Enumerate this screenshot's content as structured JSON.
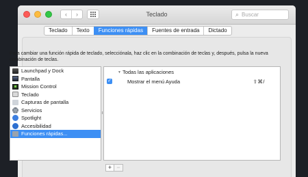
{
  "window": {
    "title": "Teclado",
    "search_placeholder": "Buscar"
  },
  "nav": {
    "back_glyph": "‹",
    "forward_glyph": "›"
  },
  "icons": {
    "search_glyph": "⌕",
    "checkmark_glyph": "✓",
    "disclosure_glyph": "▼"
  },
  "tabs": [
    {
      "label": "Teclado",
      "active": false
    },
    {
      "label": "Texto",
      "active": false
    },
    {
      "label": "Funciones rápidas",
      "active": true
    },
    {
      "label": "Fuentes de entrada",
      "active": false
    },
    {
      "label": "Dictado",
      "active": false
    }
  ],
  "description": "Para cambiar una función rápida de teclado, selecciónala, haz clic en la combinación de teclas y, después, pulsa la nueva combinación de teclas.",
  "categories": [
    {
      "label": "Launchpad y Dock",
      "icon": "launchpad-icon"
    },
    {
      "label": "Pantalla",
      "icon": "display-icon"
    },
    {
      "label": "Mission Control",
      "icon": "mission-control-icon"
    },
    {
      "label": "Teclado",
      "icon": "keyboard-icon"
    },
    {
      "label": "Capturas de pantalla",
      "icon": "screenshot-icon"
    },
    {
      "label": "Servicios",
      "icon": "gear-icon"
    },
    {
      "label": "Spotlight",
      "icon": "spotlight-icon"
    },
    {
      "label": "Accesibilidad",
      "icon": "accessibility-icon"
    },
    {
      "label": "Funciones rápidas...",
      "icon": "app-shortcuts-icon",
      "selected": true
    }
  ],
  "shortcuts": {
    "group_label": "Todas las aplicaciones",
    "rows": [
      {
        "label": "Mostrar el menú Ayuda",
        "keys": "⇧⌘/",
        "checked": true
      }
    ]
  },
  "controls": {
    "add_label": "+",
    "remove_label": "−"
  },
  "colors": {
    "accent": "#3d8ff4",
    "close": "#fc5b57",
    "minimize": "#fdbc40",
    "zoom": "#33c748"
  }
}
